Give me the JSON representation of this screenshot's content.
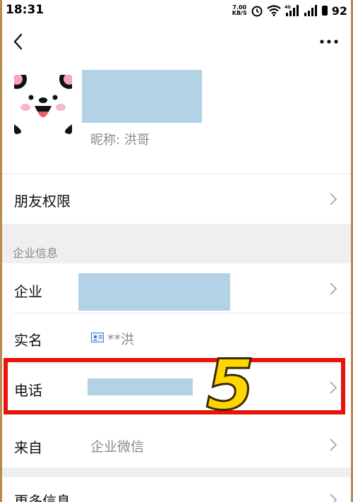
{
  "status_bar": {
    "time": "18:31",
    "net_speed_value": "7.00",
    "net_speed_unit": "KB/S",
    "battery": "92"
  },
  "profile": {
    "nickname_label": "昵称:",
    "nickname_value": "洪哥"
  },
  "rows": {
    "friend_permissions": "朋友权限",
    "enterprise_section_title": "企业信息",
    "company_label": "企业",
    "realname_label": "实名",
    "realname_value": "**洪",
    "phone_label": "电话",
    "from_label": "来自",
    "from_value": "企业微信",
    "more_info_label": "更多信息"
  },
  "annotation": {
    "step_number": "5"
  },
  "colors": {
    "highlight": "#e8140c",
    "step_number": "#ffd600",
    "redaction": "#b4d2e6",
    "section_bg": "#efefef"
  }
}
